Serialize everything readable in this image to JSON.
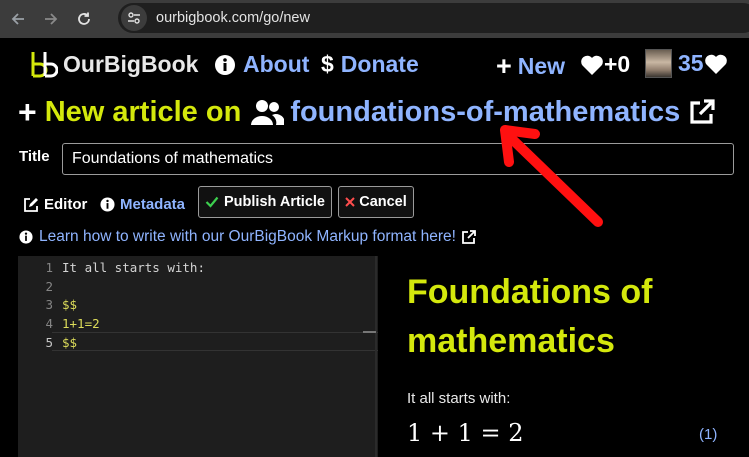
{
  "browser": {
    "url": "ourbigbook.com/go/new"
  },
  "nav": {
    "brand": "OurBigBook",
    "about": "About",
    "donate_symbol": "$",
    "donate": "Donate",
    "new_symbol": "+",
    "new": "New",
    "score": "+0",
    "user_score": "35"
  },
  "heading": {
    "plus": "+",
    "lead": "New article on",
    "topic": "foundations-of-mathematics"
  },
  "form": {
    "title_label": "Title",
    "title_value": "Foundations of mathematics",
    "editor_tab": "Editor",
    "metadata_tab": "Metadata",
    "publish_button": "Publish Article",
    "cancel_button": "Cancel",
    "learn_link": "Learn how to write with our OurBigBook Markup format here!"
  },
  "editor": {
    "lines": [
      {
        "num": "1",
        "text": "It all starts with:"
      },
      {
        "num": "2",
        "text": ""
      },
      {
        "num": "3",
        "text": "$$"
      },
      {
        "num": "4",
        "text": "1+1=2"
      },
      {
        "num": "5",
        "text": "$$"
      }
    ]
  },
  "preview": {
    "title": "Foundations of mathematics",
    "text": "It all starts with:",
    "math": "1 + 1 = 2",
    "eq_number": "(1)"
  },
  "colors": {
    "accent_yellow": "#d4e80c",
    "link_blue": "#8fb4ff",
    "annotation_red": "#ff1010"
  }
}
